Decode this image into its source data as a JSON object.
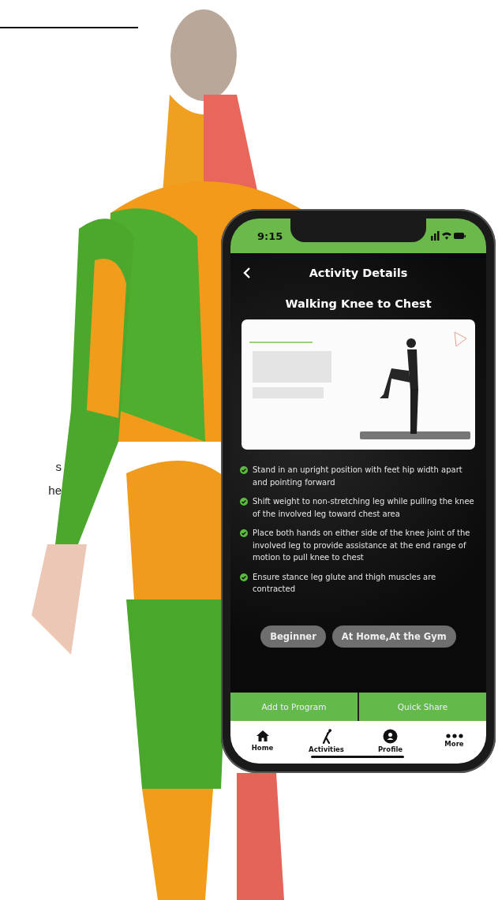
{
  "page": {
    "fragments": [
      "s",
      "he"
    ]
  },
  "phone": {
    "status_time": "9:15",
    "header": {
      "title": "Activity Details"
    },
    "exercise_title": "Walking Knee to Chest",
    "steps": [
      "Stand in an upright position with feet hip width apart and pointing forward",
      "Shift weight to non-stretching leg while pulling the knee of the involved leg toward chest area",
      "Place both hands on either side of the knee joint of the involved leg to provide assistance at the end range of motion to pull knee to chest",
      "Ensure stance leg glute and thigh muscles are contracted"
    ],
    "tags": [
      "Beginner",
      "At Home,At the Gym"
    ],
    "actions": [
      "Add to Program",
      "Quick Share"
    ],
    "nav": [
      {
        "label": "Home",
        "kind": "home"
      },
      {
        "label": "Activities",
        "kind": "activities"
      },
      {
        "label": "Profile",
        "kind": "profile"
      },
      {
        "label": "More",
        "kind": "more"
      }
    ]
  }
}
